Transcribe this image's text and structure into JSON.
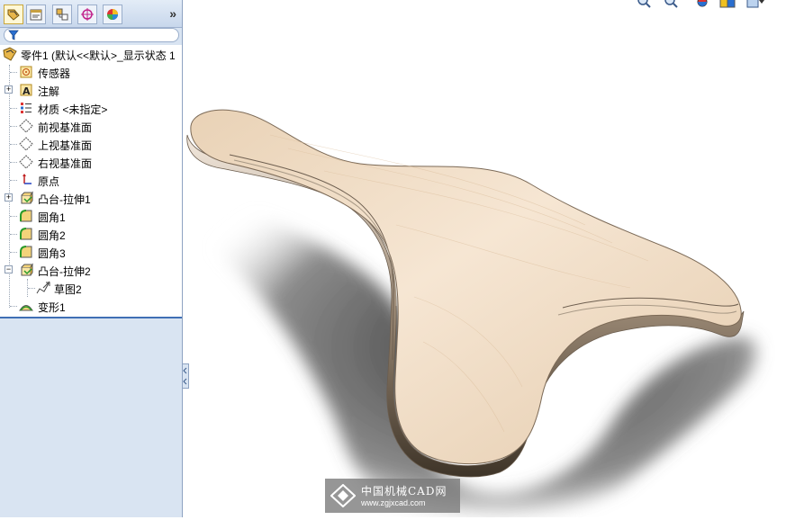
{
  "panel": {
    "tabs": [
      {
        "name": "featuremanager-tab",
        "icon": "feature-tree-icon"
      },
      {
        "name": "propertymanager-tab",
        "icon": "property-manager-icon"
      },
      {
        "name": "configurationmanager-tab",
        "icon": "configuration-icon"
      },
      {
        "name": "dimxpert-tab",
        "icon": "dimxpert-icon"
      },
      {
        "name": "display-manager-tab",
        "icon": "appearance-icon"
      }
    ],
    "more_label": "»",
    "filter_icon": "filter-icon"
  },
  "tree": {
    "root_label": "零件1 (默认<<默认>_显示状态 1",
    "items": [
      {
        "label": "传感器",
        "icon": "sensor-icon"
      },
      {
        "label": "注解",
        "icon": "annotation-icon"
      },
      {
        "label": "材质 <未指定>",
        "icon": "material-icon"
      },
      {
        "label": "前视基准面",
        "icon": "plane-icon"
      },
      {
        "label": "上视基准面",
        "icon": "plane-icon"
      },
      {
        "label": "右视基准面",
        "icon": "plane-icon"
      },
      {
        "label": "原点",
        "icon": "origin-icon"
      },
      {
        "label": "凸台-拉伸1",
        "icon": "extrude-icon"
      },
      {
        "label": "圆角1",
        "icon": "fillet-icon"
      },
      {
        "label": "圆角2",
        "icon": "fillet-icon"
      },
      {
        "label": "圆角3",
        "icon": "fillet-icon"
      },
      {
        "label": "凸台-拉伸2",
        "icon": "extrude-icon"
      },
      {
        "label": "草图2",
        "icon": "sketch-icon"
      },
      {
        "label": "变形1",
        "icon": "flex-icon"
      }
    ]
  },
  "viewport": {
    "model_colors": {
      "top": "#ecd6bd",
      "side": "#8a7a68",
      "shadow": "#3a3a3a"
    },
    "view_tools": [
      "zoom-to-fit-icon",
      "zoom-area-icon",
      "rotate-view-icon",
      "section-view-icon",
      "view-orientation-icon"
    ]
  },
  "watermark": {
    "text_cn": "中国机械CAD网",
    "url": "www.zgjxcad.com"
  }
}
